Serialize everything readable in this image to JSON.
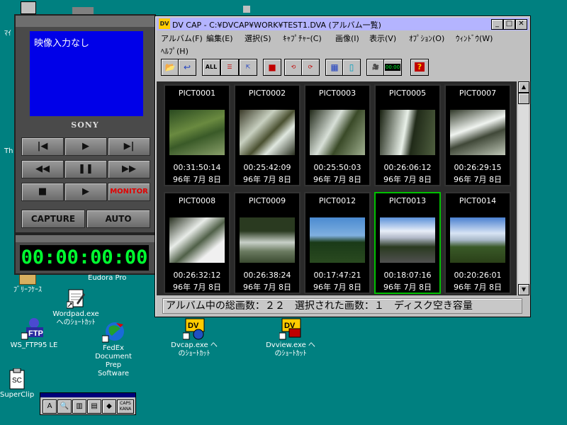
{
  "window": {
    "title": "DV CAP - C:¥DVCAP¥WORK¥TEST1.DVA (アルバム一覧)",
    "app_icon": "DV"
  },
  "menubar": {
    "row1": [
      "アルバム(F)",
      "編集(E)",
      "選択(S)",
      "ｷｬﾌﾟﾁｬｰ(C)",
      "画像(I)",
      "表示(V)",
      "ｵﾌﾟｼｮﾝ(O)",
      "ｳｨﾝﾄﾞｳ(W)"
    ],
    "row2": [
      "ﾍﾙﾌﾟ(H)"
    ]
  },
  "toolbar": {
    "all_label": "ALL",
    "help_label": "?",
    "timecode_label": "00:00"
  },
  "album": [
    {
      "name": "PICT0001",
      "timecode": "00:31:50:14",
      "date": "96年 7月 8日"
    },
    {
      "name": "PICT0002",
      "timecode": "00:25:42:09",
      "date": "96年 7月 8日"
    },
    {
      "name": "PICT0003",
      "timecode": "00:25:50:03",
      "date": "96年 7月 8日"
    },
    {
      "name": "PICT0005",
      "timecode": "00:26:06:12",
      "date": "96年 7月 8日"
    },
    {
      "name": "PICT0007",
      "timecode": "00:26:29:15",
      "date": "96年 7月 8日"
    },
    {
      "name": "PICT0008",
      "timecode": "00:26:32:12",
      "date": "96年 7月 8日"
    },
    {
      "name": "PICT0009",
      "timecode": "00:26:38:24",
      "date": "96年 7月 8日"
    },
    {
      "name": "PICT0012",
      "timecode": "00:17:47:21",
      "date": "96年 7月 8日"
    },
    {
      "name": "PICT0013",
      "timecode": "00:18:07:16",
      "date": "96年 7月 8日"
    },
    {
      "name": "PICT0014",
      "timecode": "00:20:26:01",
      "date": "96年 7月 8日"
    }
  ],
  "status_bar": {
    "text": "アルバム中の総画数：２２　選択された画数：１　ディスク空き容量"
  },
  "control_panel": {
    "screen_text": "映像入力なし",
    "brand": "SONY",
    "monitor_label": "MONITOR",
    "capture_label": "CAPTURE",
    "auto_label": "AUTO",
    "timer_value": "00:00:00:00"
  },
  "desktop": {
    "eudora": "Eudora Pro",
    "briefcase": "ﾌﾞﾘｰﾌｹｰｽ",
    "wordpad": "Wordpad.exe\nへのｼｮｰﾄｶｯﾄ",
    "ftp": "WS_FTP95 LE",
    "fedex": "FedEx\nDocument\nPrep\nSoftware",
    "dvcap": "Dvcap.exe へ\nのｼｮｰﾄｶｯﾄ",
    "dvview": "Dvview.exe へ\nのｼｮｰﾄｶｯﾄ",
    "superclip": "SuperClip",
    "partial_1": "ﾏｲ",
    "partial_2": "Th"
  },
  "ime": {
    "keys": [
      "A",
      "CAPS\nKANA"
    ]
  },
  "colors": {
    "desktop": "#008080",
    "screen_blue": "#0000e8",
    "timer_green": "#00ff30",
    "selection_green": "#00c000",
    "monitor_red": "#e00000"
  }
}
